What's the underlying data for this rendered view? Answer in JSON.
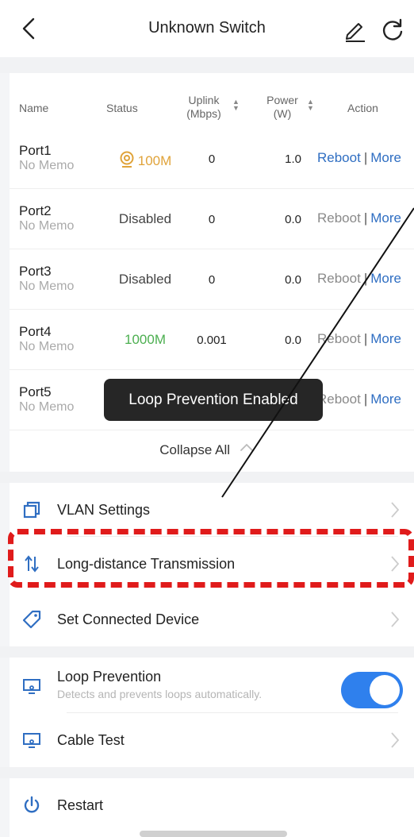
{
  "header": {
    "title": "Unknown Switch"
  },
  "table": {
    "columns": {
      "name": "Name",
      "status": "Status",
      "uplink_l1": "Uplink",
      "uplink_l2": "(Mbps)",
      "power_l1": "Power",
      "power_l2": "(W)",
      "action": "Action"
    },
    "ports": [
      {
        "name": "Port1",
        "memo": "No Memo",
        "status": "100M",
        "uplink": "0",
        "power": "1.0",
        "reboot": "Reboot",
        "sep": "|",
        "more": "More"
      },
      {
        "name": "Port2",
        "memo": "No Memo",
        "status": "Disabled",
        "uplink": "0",
        "power": "0.0",
        "reboot": "Reboot",
        "sep": "|",
        "more": "More"
      },
      {
        "name": "Port3",
        "memo": "No Memo",
        "status": "Disabled",
        "uplink": "0",
        "power": "0.0",
        "reboot": "Reboot",
        "sep": "|",
        "more": "More"
      },
      {
        "name": "Port4",
        "memo": "No Memo",
        "status": "1000M",
        "uplink": "0.001",
        "power": "0.0",
        "reboot": "Reboot",
        "sep": "|",
        "more": "More"
      },
      {
        "name": "Port5",
        "memo": "No Memo",
        "reboot": "Reboot",
        "sep": "|",
        "more": "More"
      }
    ],
    "collapse_label": "Collapse All"
  },
  "toast": {
    "text": "Loop Prevention Enabled"
  },
  "menu": {
    "vlan": "VLAN Settings",
    "long_distance": "Long-distance Transmission",
    "connected_device": "Set Connected Device",
    "loop_prevention": "Loop Prevention",
    "loop_prevention_desc": "Detects and prevents loops automatically.",
    "cable_test": "Cable Test",
    "restart": "Restart"
  },
  "loop_prevention_enabled": true,
  "colors": {
    "accent": "#2f80ed",
    "link_blue": "#2f6ec2",
    "status_100m": "#e0a33a",
    "status_1000m": "#4caf50",
    "annotation_red": "#e01b1b"
  },
  "icons": {
    "back": "chevron-left-icon",
    "edit": "pencil-icon",
    "refresh": "refresh-icon",
    "poe": "poe-camera-icon",
    "vlan": "vlan-icon",
    "long_distance": "sort-arrows-icon",
    "connected_device": "tag-icon",
    "loop": "monitor-icon",
    "cable": "monitor-icon",
    "restart": "power-icon"
  }
}
